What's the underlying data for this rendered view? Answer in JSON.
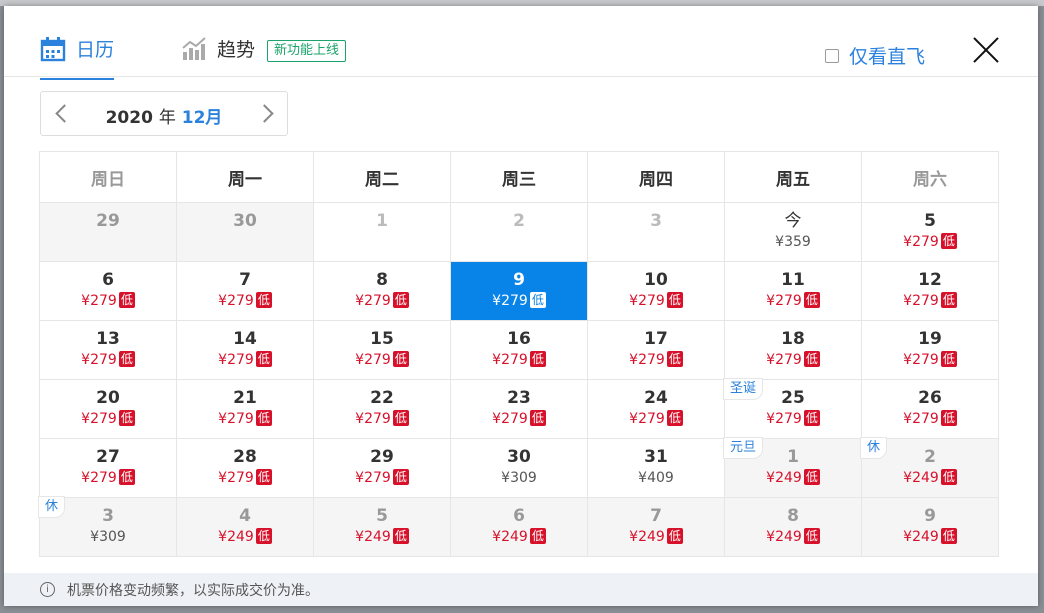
{
  "tabs": {
    "calendar": "日历",
    "trend": "趋势",
    "new_badge": "新功能上线"
  },
  "direct_only": {
    "label": "仅看直飞",
    "checked": false
  },
  "month_nav": {
    "year": "2020",
    "year_suffix": "年",
    "month": "12月"
  },
  "weekdays": [
    "周日",
    "周一",
    "周二",
    "周三",
    "周四",
    "周五",
    "周六"
  ],
  "weeks": [
    [
      {
        "day": "29",
        "price": "",
        "low": false,
        "state": "out"
      },
      {
        "day": "30",
        "price": "",
        "low": false,
        "state": "out"
      },
      {
        "day": "1",
        "price": "",
        "low": false,
        "state": "dim"
      },
      {
        "day": "2",
        "price": "",
        "low": false,
        "state": "dim"
      },
      {
        "day": "3",
        "price": "",
        "low": false,
        "state": "dim"
      },
      {
        "day": "今",
        "price": "¥359",
        "low": false,
        "state": "today"
      },
      {
        "day": "5",
        "price": "¥279",
        "low": true,
        "state": ""
      }
    ],
    [
      {
        "day": "6",
        "price": "¥279",
        "low": true,
        "state": ""
      },
      {
        "day": "7",
        "price": "¥279",
        "low": true,
        "state": ""
      },
      {
        "day": "8",
        "price": "¥279",
        "low": true,
        "state": ""
      },
      {
        "day": "9",
        "price": "¥279",
        "low": true,
        "state": "sel"
      },
      {
        "day": "10",
        "price": "¥279",
        "low": true,
        "state": ""
      },
      {
        "day": "11",
        "price": "¥279",
        "low": true,
        "state": ""
      },
      {
        "day": "12",
        "price": "¥279",
        "low": true,
        "state": ""
      }
    ],
    [
      {
        "day": "13",
        "price": "¥279",
        "low": true,
        "state": ""
      },
      {
        "day": "14",
        "price": "¥279",
        "low": true,
        "state": ""
      },
      {
        "day": "15",
        "price": "¥279",
        "low": true,
        "state": ""
      },
      {
        "day": "16",
        "price": "¥279",
        "low": true,
        "state": ""
      },
      {
        "day": "17",
        "price": "¥279",
        "low": true,
        "state": ""
      },
      {
        "day": "18",
        "price": "¥279",
        "low": true,
        "state": ""
      },
      {
        "day": "19",
        "price": "¥279",
        "low": true,
        "state": ""
      }
    ],
    [
      {
        "day": "20",
        "price": "¥279",
        "low": true,
        "state": ""
      },
      {
        "day": "21",
        "price": "¥279",
        "low": true,
        "state": ""
      },
      {
        "day": "22",
        "price": "¥279",
        "low": true,
        "state": ""
      },
      {
        "day": "23",
        "price": "¥279",
        "low": true,
        "state": ""
      },
      {
        "day": "24",
        "price": "¥279",
        "low": true,
        "state": ""
      },
      {
        "day": "25",
        "price": "¥279",
        "low": true,
        "state": "",
        "tag": "圣诞"
      },
      {
        "day": "26",
        "price": "¥279",
        "low": true,
        "state": ""
      }
    ],
    [
      {
        "day": "27",
        "price": "¥279",
        "low": true,
        "state": ""
      },
      {
        "day": "28",
        "price": "¥279",
        "low": true,
        "state": ""
      },
      {
        "day": "29",
        "price": "¥279",
        "low": true,
        "state": ""
      },
      {
        "day": "30",
        "price": "¥309",
        "low": false,
        "state": ""
      },
      {
        "day": "31",
        "price": "¥409",
        "low": false,
        "state": ""
      },
      {
        "day": "1",
        "price": "¥249",
        "low": true,
        "state": "out",
        "tag": "元旦"
      },
      {
        "day": "2",
        "price": "¥249",
        "low": true,
        "state": "out",
        "tag": "休"
      }
    ],
    [
      {
        "day": "3",
        "price": "¥309",
        "low": false,
        "state": "out",
        "tag": "休"
      },
      {
        "day": "4",
        "price": "¥249",
        "low": true,
        "state": "out"
      },
      {
        "day": "5",
        "price": "¥249",
        "low": true,
        "state": "out"
      },
      {
        "day": "6",
        "price": "¥249",
        "low": true,
        "state": "out"
      },
      {
        "day": "7",
        "price": "¥249",
        "low": true,
        "state": "out"
      },
      {
        "day": "8",
        "price": "¥249",
        "low": true,
        "state": "out"
      },
      {
        "day": "9",
        "price": "¥249",
        "low": true,
        "state": "out"
      }
    ]
  ],
  "low_label": "低",
  "footer": {
    "text": "机票价格变动频繁，以实际成交价为准。",
    "icon": "info-icon"
  },
  "colors": {
    "accent": "#2b82dc",
    "selected": "#0883e8",
    "price_red": "#d8112b",
    "badge_green": "#1aa36a"
  }
}
